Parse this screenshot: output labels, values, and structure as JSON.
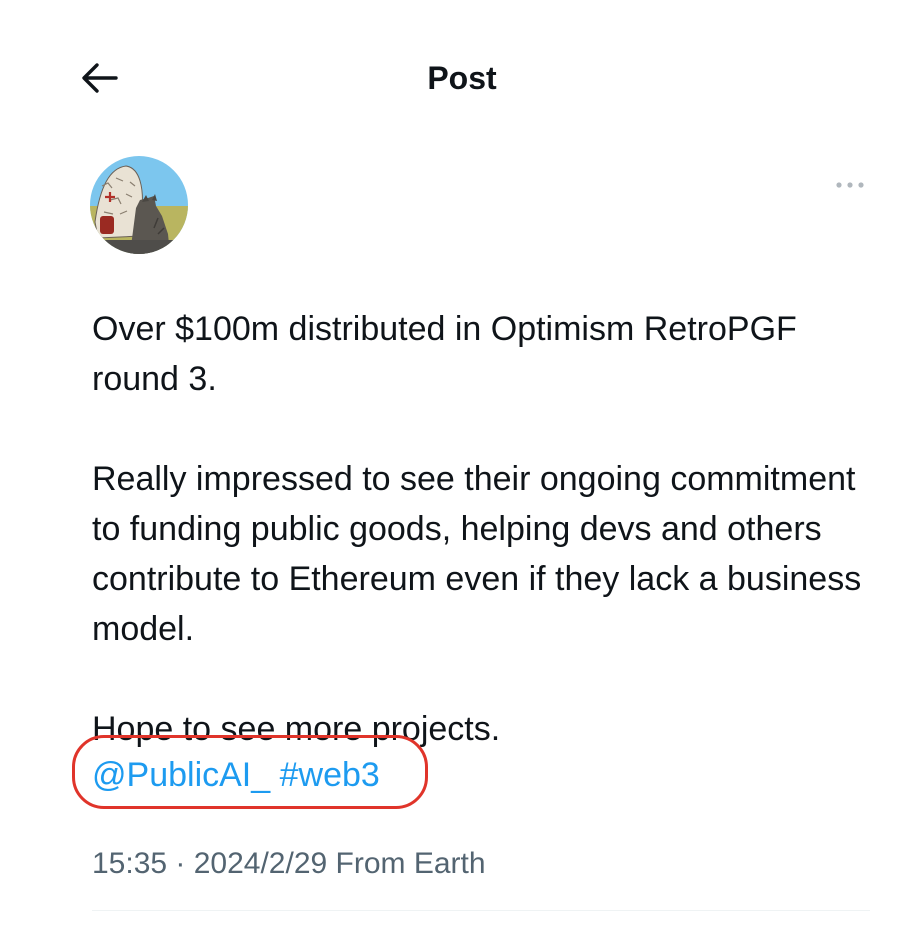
{
  "header": {
    "back_icon": "arrow-left-icon",
    "title": "Post"
  },
  "post": {
    "more_icon": "more-horizontal-icon",
    "paragraphs": [
      "Over $100m distributed in Optimism RetroPGF round 3.",
      "Really impressed to see their ongoing commitment to funding public goods, helping devs and others contribute to Ethereum even if they lack a business model.",
      "Hope to see more projects."
    ],
    "mention": "@PublicAI_",
    "hashtag": "#web3",
    "timestamp": "15:35 · 2024/2/29 From Earth"
  },
  "colors": {
    "link": "#1d9bf0",
    "highlight_outline": "#e0342a",
    "text": "#0f1419",
    "secondary_text": "#536471"
  }
}
